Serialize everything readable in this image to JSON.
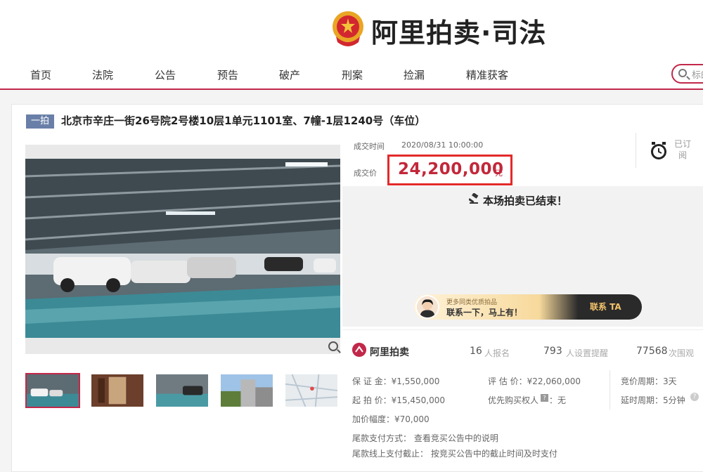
{
  "brand": {
    "logo_text": "阿里拍卖·司法"
  },
  "nav": {
    "items": [
      {
        "label": "首页"
      },
      {
        "label": "法院"
      },
      {
        "label": "公告"
      },
      {
        "label": "预告"
      },
      {
        "label": "破产"
      },
      {
        "label": "刑案"
      },
      {
        "label": "捡漏"
      },
      {
        "label": "精准获客"
      }
    ],
    "search_placeholder": "标的"
  },
  "lot": {
    "tag": "一拍",
    "title": "北京市辛庄一街26号院2号楼10层1单元1101室、7幢-1层1240号（车位）",
    "deal_time_label": "成交时间",
    "deal_time": "2020/08/31 10:00:00",
    "deal_price_label": "成交价",
    "deal_price": "24,200,000",
    "price_unit": "元",
    "reminder": "已订阅",
    "status_text": "本场拍卖已结束！"
  },
  "contact_banner": {
    "sub": "更多同类优质拍品",
    "main": "联系一下，马上有！",
    "button": "联系 TA"
  },
  "stats": {
    "platform": "阿里拍卖",
    "registered": "16",
    "registered_label": "人报名",
    "reminders": "793",
    "reminders_label": "人设置提醒",
    "views": "77568",
    "views_label": "次围观"
  },
  "details": {
    "deposit": "保 证 金：¥1,550,000",
    "start_price": "起 拍 价：¥15,450,000",
    "increment": "加价幅度：¥70,000",
    "appraisal": "评 估 价：¥22,060,000",
    "priority": "优先购买权人",
    "priority_value": "：无",
    "cycle": "竞价周期：3天",
    "delay": "延时周期：5分钟",
    "payment_method": "尾款支付方式：  查看竞买公告中的说明",
    "payment_deadline": "尾款线上支付截止：  按竞买公告中的截止时间及时支付"
  },
  "colors": {
    "brand": "#c2284a",
    "price": "#c2283a",
    "price_box": "#e32a2a",
    "tag": "#6a7fa8"
  },
  "icons": [
    "court-emblem-icon",
    "search-icon",
    "zoom-icon",
    "clock-icon",
    "gavel-icon",
    "alipaimai-logo-icon",
    "help-icon"
  ]
}
